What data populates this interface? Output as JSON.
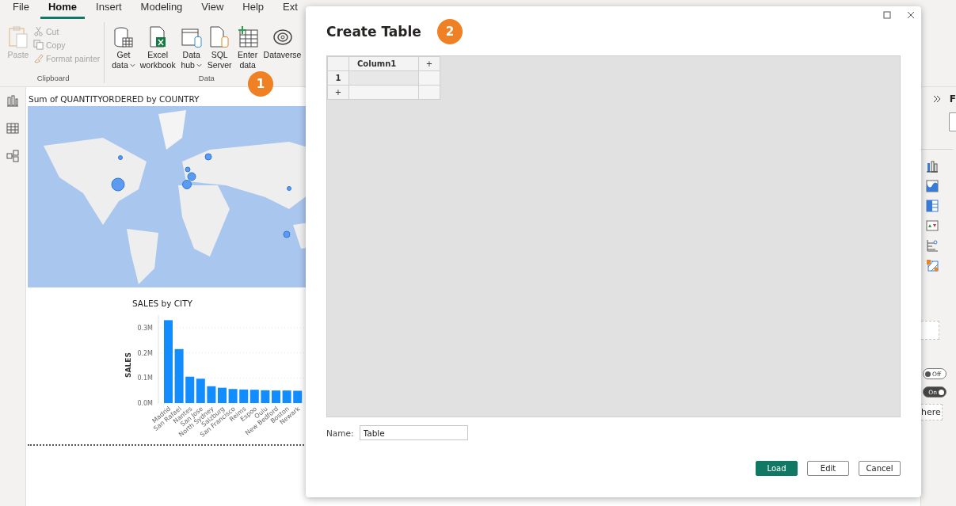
{
  "menu_tabs": [
    {
      "label": "File",
      "selected": false
    },
    {
      "label": "Home",
      "selected": true
    },
    {
      "label": "Insert",
      "selected": false
    },
    {
      "label": "Modeling",
      "selected": false
    },
    {
      "label": "View",
      "selected": false
    },
    {
      "label": "Help",
      "selected": false
    },
    {
      "label": "Ext",
      "selected": false
    }
  ],
  "ribbon": {
    "groups": [
      {
        "label": "Clipboard",
        "kind": "clipboard",
        "buttons": [
          {
            "kind": "paste",
            "lines": [
              "Paste"
            ],
            "disabled": true
          },
          {
            "kind": "cut",
            "lines": [
              "Cut"
            ],
            "disabled": true
          },
          {
            "kind": "copy",
            "lines": [
              "Copy"
            ],
            "disabled": true
          },
          {
            "kind": "format-painter",
            "lines": [
              "Format painter"
            ],
            "disabled": true
          }
        ]
      },
      {
        "label": "Data",
        "kind": "large",
        "buttons": [
          {
            "kind": "get-data",
            "lines": [
              "Get",
              "data"
            ],
            "disabled": false,
            "dropdown": true
          },
          {
            "kind": "excel",
            "lines": [
              "Excel",
              "workbook"
            ],
            "disabled": false,
            "dropdown": false
          },
          {
            "kind": "data-hub",
            "lines": [
              "Data",
              "hub"
            ],
            "disabled": false,
            "dropdown": true
          },
          {
            "kind": "sql",
            "lines": [
              "SQL",
              "Server"
            ],
            "disabled": false,
            "dropdown": false
          },
          {
            "kind": "enter-data",
            "lines": [
              "Enter",
              "data"
            ],
            "disabled": false,
            "dropdown": false
          },
          {
            "kind": "dataverse",
            "lines": [
              "Dataverse"
            ],
            "disabled": false,
            "dropdown": false
          }
        ]
      }
    ],
    "step_badge": "1"
  },
  "left_rail": {
    "items": [
      {
        "kind": "report"
      },
      {
        "kind": "table"
      },
      {
        "kind": "model"
      }
    ]
  },
  "report": {
    "map_visual": {
      "title": "Sum of QUANTITYORDERED by COUNTRY"
    },
    "bar_visual": {
      "chart_data": {
        "type": "bar",
        "title": "SALES by CITY",
        "ylabel": "SALES",
        "categories": [
          "Madrid",
          "San Rafael",
          "Nantes",
          "San Jose",
          "North Sydney",
          "Salzburg",
          "San Francisco",
          "Reims",
          "Espoo",
          "Oulu",
          "New Bedford",
          "Boston",
          "Newark"
        ],
        "values": [
          0.33,
          0.215,
          0.105,
          0.097,
          0.067,
          0.061,
          0.056,
          0.054,
          0.053,
          0.051,
          0.05,
          0.05,
          0.049
        ],
        "grid": true,
        "ylim": [
          0,
          0.35
        ],
        "yticks": [
          {
            "value": 0,
            "label": "0.0M"
          },
          {
            "value": 0.1,
            "label": "0.1M"
          },
          {
            "value": 0.2,
            "label": "0.2M"
          },
          {
            "value": 0.3,
            "label": "0.3M"
          }
        ]
      }
    }
  },
  "right_pane": {
    "title": "F",
    "visual_icons": [
      {
        "kind": "column"
      },
      {
        "kind": "area"
      },
      {
        "kind": "matrix"
      },
      {
        "kind": "kpi"
      },
      {
        "kind": "tree"
      },
      {
        "kind": "map"
      }
    ],
    "toggles": [
      {
        "label": "Off",
        "on": false
      },
      {
        "label": "On",
        "on": true
      }
    ],
    "drop_hint": "here"
  },
  "dialog": {
    "title": "Create Table",
    "step_badge": "2",
    "grid": {
      "columns": [
        "Column1"
      ],
      "add_column": "+",
      "rows": [
        {
          "header": "1"
        }
      ],
      "add_row": "+"
    },
    "name_field": {
      "label": "Name:",
      "value": "Table"
    },
    "buttons": [
      {
        "label": "Load",
        "primary": true
      },
      {
        "label": "Edit",
        "primary": false
      },
      {
        "label": "Cancel",
        "primary": false
      }
    ]
  }
}
